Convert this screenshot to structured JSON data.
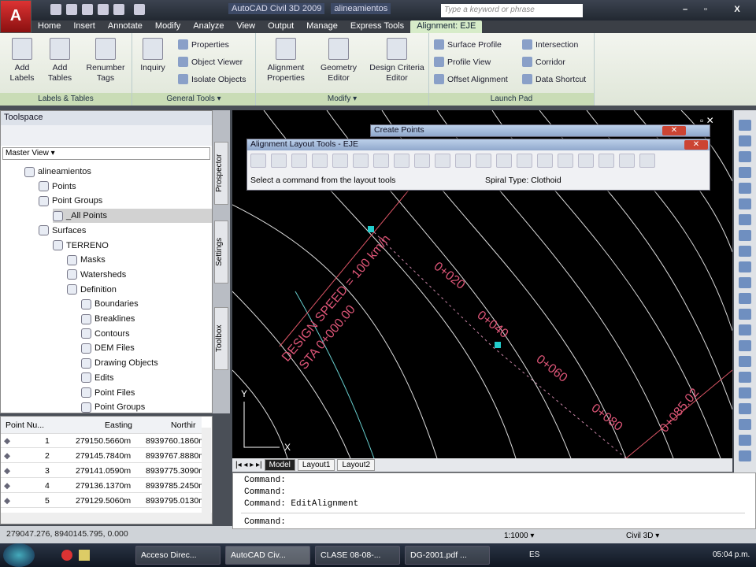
{
  "titlebar": {
    "app": "AutoCAD Civil 3D 2009",
    "file": "alineamientos",
    "search_placeholder": "Type a keyword or phrase",
    "minimize": "–",
    "maximize": "▫",
    "close": "X"
  },
  "tabs": [
    "Home",
    "Insert",
    "Annotate",
    "Modify",
    "Analyze",
    "View",
    "Output",
    "Manage",
    "Express Tools",
    "Alignment: EJE"
  ],
  "ribbon": {
    "labels_tables": {
      "title": "Labels & Tables",
      "add_labels": "Add Labels",
      "add_tables": "Add Tables",
      "renumber_tags": "Renumber Tags"
    },
    "general_tools": {
      "title": "General Tools ▾",
      "inquiry": "Inquiry",
      "properties": "Properties",
      "object_viewer": "Object Viewer",
      "isolate_objects": "Isolate Objects"
    },
    "modify": {
      "title": "Modify ▾",
      "alignment_properties": "Alignment Properties",
      "geometry_editor": "Geometry Editor",
      "design_criteria_editor": "Design Criteria Editor"
    },
    "launch_pad": {
      "title": "Launch Pad",
      "surface_profile": "Surface Profile",
      "profile_view": "Profile View",
      "offset_alignment": "Offset Alignment",
      "intersection": "Intersection",
      "corridor": "Corridor",
      "data_shortcut": "Data Shortcut"
    }
  },
  "toolspace": {
    "title": "Toolspace",
    "view": "Master View ▾",
    "tree": [
      "alineamientos",
      "Points",
      "Point Groups",
      "_All Points",
      "Surfaces",
      "TERRENO",
      "Masks",
      "Watersheds",
      "Definition",
      "Boundaries",
      "Breaklines",
      "Contours",
      "DEM Files",
      "Drawing Objects",
      "Edits",
      "Point Files",
      "Point Groups"
    ],
    "side_tabs": [
      "Prospector",
      "Settings",
      "Toolbox"
    ]
  },
  "points_table": {
    "headers": [
      "Point Nu...",
      "Easting",
      "Northir"
    ],
    "rows": [
      [
        "1",
        "279150.5660m",
        "8939760.1860m"
      ],
      [
        "2",
        "279145.7840m",
        "8939767.8880m"
      ],
      [
        "3",
        "279141.0590m",
        "8939775.3090m"
      ],
      [
        "4",
        "279136.1370m",
        "8939785.2450m"
      ],
      [
        "5",
        "279129.5060m",
        "8939795.0130m"
      ]
    ]
  },
  "coordinates": "279047.276, 8940145.795, 0.000",
  "create_points": {
    "title": "Create Points"
  },
  "alignment_tools": {
    "title": "Alignment Layout Tools - EJE",
    "prompt": "Select a command from the layout tools",
    "spiral": "Spiral Type: Clothoid"
  },
  "drawing": {
    "design_speed": "DESIGN SPEED = 100 km/h",
    "sta_start": "STA 0+000.00",
    "stations": [
      "0+020",
      "0+040",
      "0+060",
      "0+080"
    ],
    "sta_end": "0+085.02",
    "axis_x": "X",
    "axis_y": "Y"
  },
  "layout_tabs": [
    "Model",
    "Layout1",
    "Layout2"
  ],
  "command_lines": [
    "Command:",
    "Command:",
    "Command: EditAlignment",
    "Command:"
  ],
  "statusbar": {
    "scale": "1:1000 ▾",
    "workspace": "Civil 3D ▾"
  },
  "taskbar": {
    "items": [
      "Acceso Direc...",
      "AutoCAD Civ...",
      "CLASE 08-08-...",
      "DG-2001.pdf ..."
    ],
    "lang": "ES",
    "time": "05:04 p.m."
  }
}
